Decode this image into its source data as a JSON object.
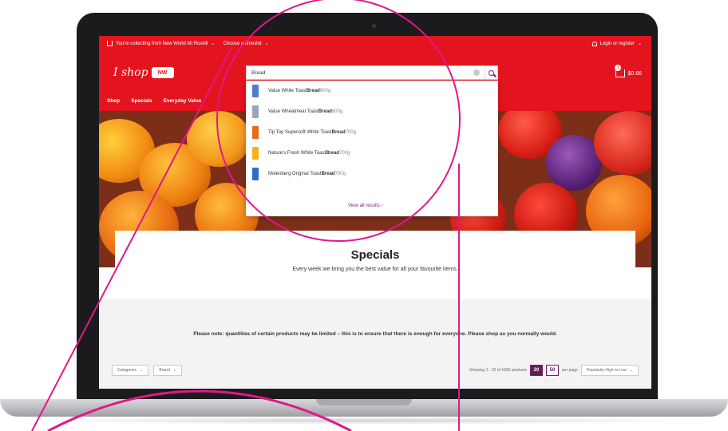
{
  "topbar": {
    "collect_text": "You're collecting from New World Mt Roskill",
    "timeslot_text": "Choose a timeslot",
    "login_text": "Login or register"
  },
  "header": {
    "logo_text": "I shop",
    "logo_badge": "NW",
    "cart_total": "$0.66",
    "cart_count": "1"
  },
  "nav": {
    "items": [
      "Shop",
      "Specials",
      "Everyday Value"
    ]
  },
  "search": {
    "value": "Bread",
    "suggestions": [
      {
        "name": "Value White Toast ",
        "bold": "Bread",
        "size": " 600g",
        "color": "#4a7fd0"
      },
      {
        "name": "Value Wheatmeal Toast ",
        "bold": "Bread",
        "size": " 600g",
        "color": "#9aa6b8"
      },
      {
        "name": "Tip Top Supersoft White Toast ",
        "bold": "Bread",
        "size": " 700g",
        "color": "#e86a1a"
      },
      {
        "name": "Nature's Fresh White Toast ",
        "bold": "Bread",
        "size": " 700g",
        "color": "#f2b21b"
      },
      {
        "name": "Molenberg Original Toast ",
        "bold": "Bread",
        "size": " 700g",
        "color": "#2b6fc4"
      }
    ],
    "view_all": "View all results ›"
  },
  "specials": {
    "title": "Specials",
    "subtitle": "Every week we bring you the best value for all your favourite items."
  },
  "notice": "Please note: quantities of certain products may be limited – this is to ensure that there is enough for everyone. Please shop as you normally would.",
  "filters": {
    "categories": "Categories",
    "brand": "Brand"
  },
  "pager": {
    "showing": "Showing 1 - 20 of 1000 products",
    "opt_20": "20",
    "opt_50": "50",
    "per_page": "per page",
    "sort": "Popularity High to Low"
  },
  "colors": {
    "brand_red": "#e3141e",
    "accent_purple": "#5e1f57",
    "annotation_magenta": "#e0188a"
  }
}
